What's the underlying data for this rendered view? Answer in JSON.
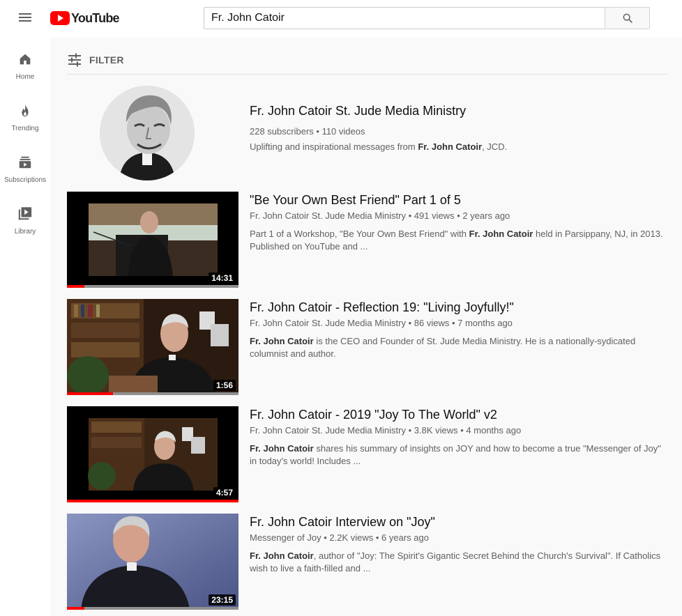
{
  "header": {
    "logo_text": "YouTube",
    "search_value": "Fr. John Catoir",
    "brand_color": "#ff0000"
  },
  "sidebar": {
    "items": [
      {
        "label": "Home",
        "icon": "home-icon"
      },
      {
        "label": "Trending",
        "icon": "flame-icon"
      },
      {
        "label": "Subscriptions",
        "icon": "subscriptions-icon"
      },
      {
        "label": "Library",
        "icon": "library-icon"
      }
    ]
  },
  "filter": {
    "label": "FILTER",
    "icon": "filter-sliders-icon"
  },
  "channel": {
    "title": "Fr. John Catoir St. Jude Media Ministry",
    "subscribers": "228 subscribers",
    "videos": "110 videos",
    "desc_before": "Uplifting and inspirational messages from ",
    "desc_bold": "Fr. John Catoir",
    "desc_after": ", JCD."
  },
  "videos": [
    {
      "title": "\"Be Your Own Best Friend\" Part 1 of 5",
      "channel": "Fr. John Catoir St. Jude Media Ministry",
      "views": "491 views",
      "age": "2 years ago",
      "desc_before": "Part 1 of a Workshop, \"Be Your Own Best Friend\" with ",
      "desc_bold": "Fr. John Catoir",
      "desc_after": " held in Parsippany, NJ, in 2013. Published on YouTube and ...",
      "duration": "14:31",
      "watched_fraction": 0.1
    },
    {
      "title": "Fr. John Catoir - Reflection 19: \"Living Joyfully!\"",
      "channel": "Fr. John Catoir St. Jude Media Ministry",
      "views": "86 views",
      "age": "7 months ago",
      "desc_before": "",
      "desc_bold": "Fr. John Catoir",
      "desc_after": " is the CEO and Founder of St. Jude Media Ministry. He is a nationally-sydicated columnist and author.",
      "duration": "1:56",
      "watched_fraction": 0.27
    },
    {
      "title": "Fr. John Catoir - 2019 \"Joy To The World\" v2",
      "channel": "Fr. John Catoir St. Jude Media Ministry",
      "views": "3.8K views",
      "age": "4 months ago",
      "desc_before": "",
      "desc_bold": "Fr. John Catoir",
      "desc_after": " shares his summary of insights on JOY and how to become a true \"Messenger of Joy\" in today's world! Includes ...",
      "duration": "4:57",
      "watched_fraction": 1.0
    },
    {
      "title": "Fr. John Catoir Interview on \"Joy\"",
      "channel": "Messenger of Joy",
      "views": "2.2K views",
      "age": "6 years ago",
      "desc_before": "",
      "desc_bold": "Fr. John Catoir",
      "desc_after": ", author of \"Joy: The Spirit's Gigantic Secret Behind the Church's Survival\". If Catholics wish to live a faith-filled and ...",
      "duration": "23:15",
      "watched_fraction": 0.1
    }
  ]
}
